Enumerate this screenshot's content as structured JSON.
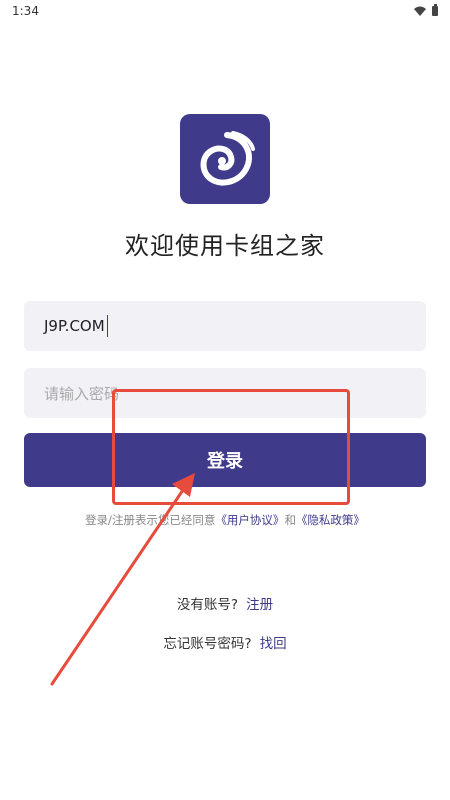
{
  "status_bar": {
    "time": "1:34"
  },
  "app": {
    "title": "欢迎使用卡组之家",
    "logo_icon": "swirl-logo-icon",
    "brand_color": "#3f3a8a"
  },
  "form": {
    "username_value": "J9P.COM",
    "password_placeholder": "请输入密码",
    "login_label": "登录"
  },
  "agreement": {
    "prefix": "登录/注册表示您已经同意",
    "user_agreement": "《用户协议》",
    "conjunction": "和",
    "privacy_policy": "《隐私政策》"
  },
  "links": {
    "no_account_text": "没有账号?",
    "register_label": "注册",
    "forgot_text": "忘记账号密码?",
    "recover_label": "找回"
  },
  "annotation": {
    "color": "#e64b3c"
  }
}
